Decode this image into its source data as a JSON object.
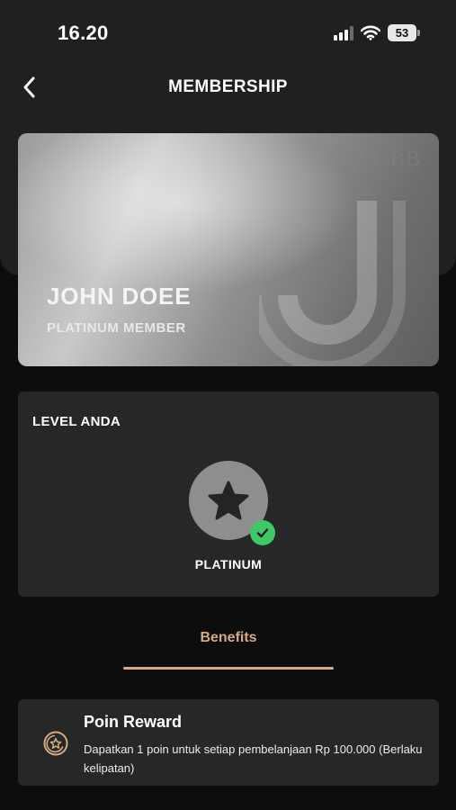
{
  "status_bar": {
    "time": "16.20",
    "battery": "53",
    "icons": [
      "signal-icon",
      "wifi-icon",
      "battery-icon"
    ]
  },
  "header": {
    "title": "MEMBERSHIP",
    "back_icon": "chevron-left-icon"
  },
  "card": {
    "brand": "JOBB",
    "name": "JOHN DOEE",
    "tier": "PLATINUM MEMBER"
  },
  "level": {
    "title": "LEVEL ANDA",
    "name": "PLATINUM",
    "icon": "star-icon",
    "badge_icon": "check-icon"
  },
  "tabs": [
    {
      "label": "Benefits",
      "active": true
    }
  ],
  "benefits": [
    {
      "icon": "star-coin-icon",
      "title": "Poin Reward",
      "description": "Dapatkan 1 poin untuk setiap pembelanjaan Rp 100.000 (Berlaku kelipatan)"
    }
  ],
  "colors": {
    "background": "#0d0d0d",
    "panel": "#202020",
    "surface": "#272727",
    "accent": "#d5ab84",
    "success": "#3ec868"
  }
}
